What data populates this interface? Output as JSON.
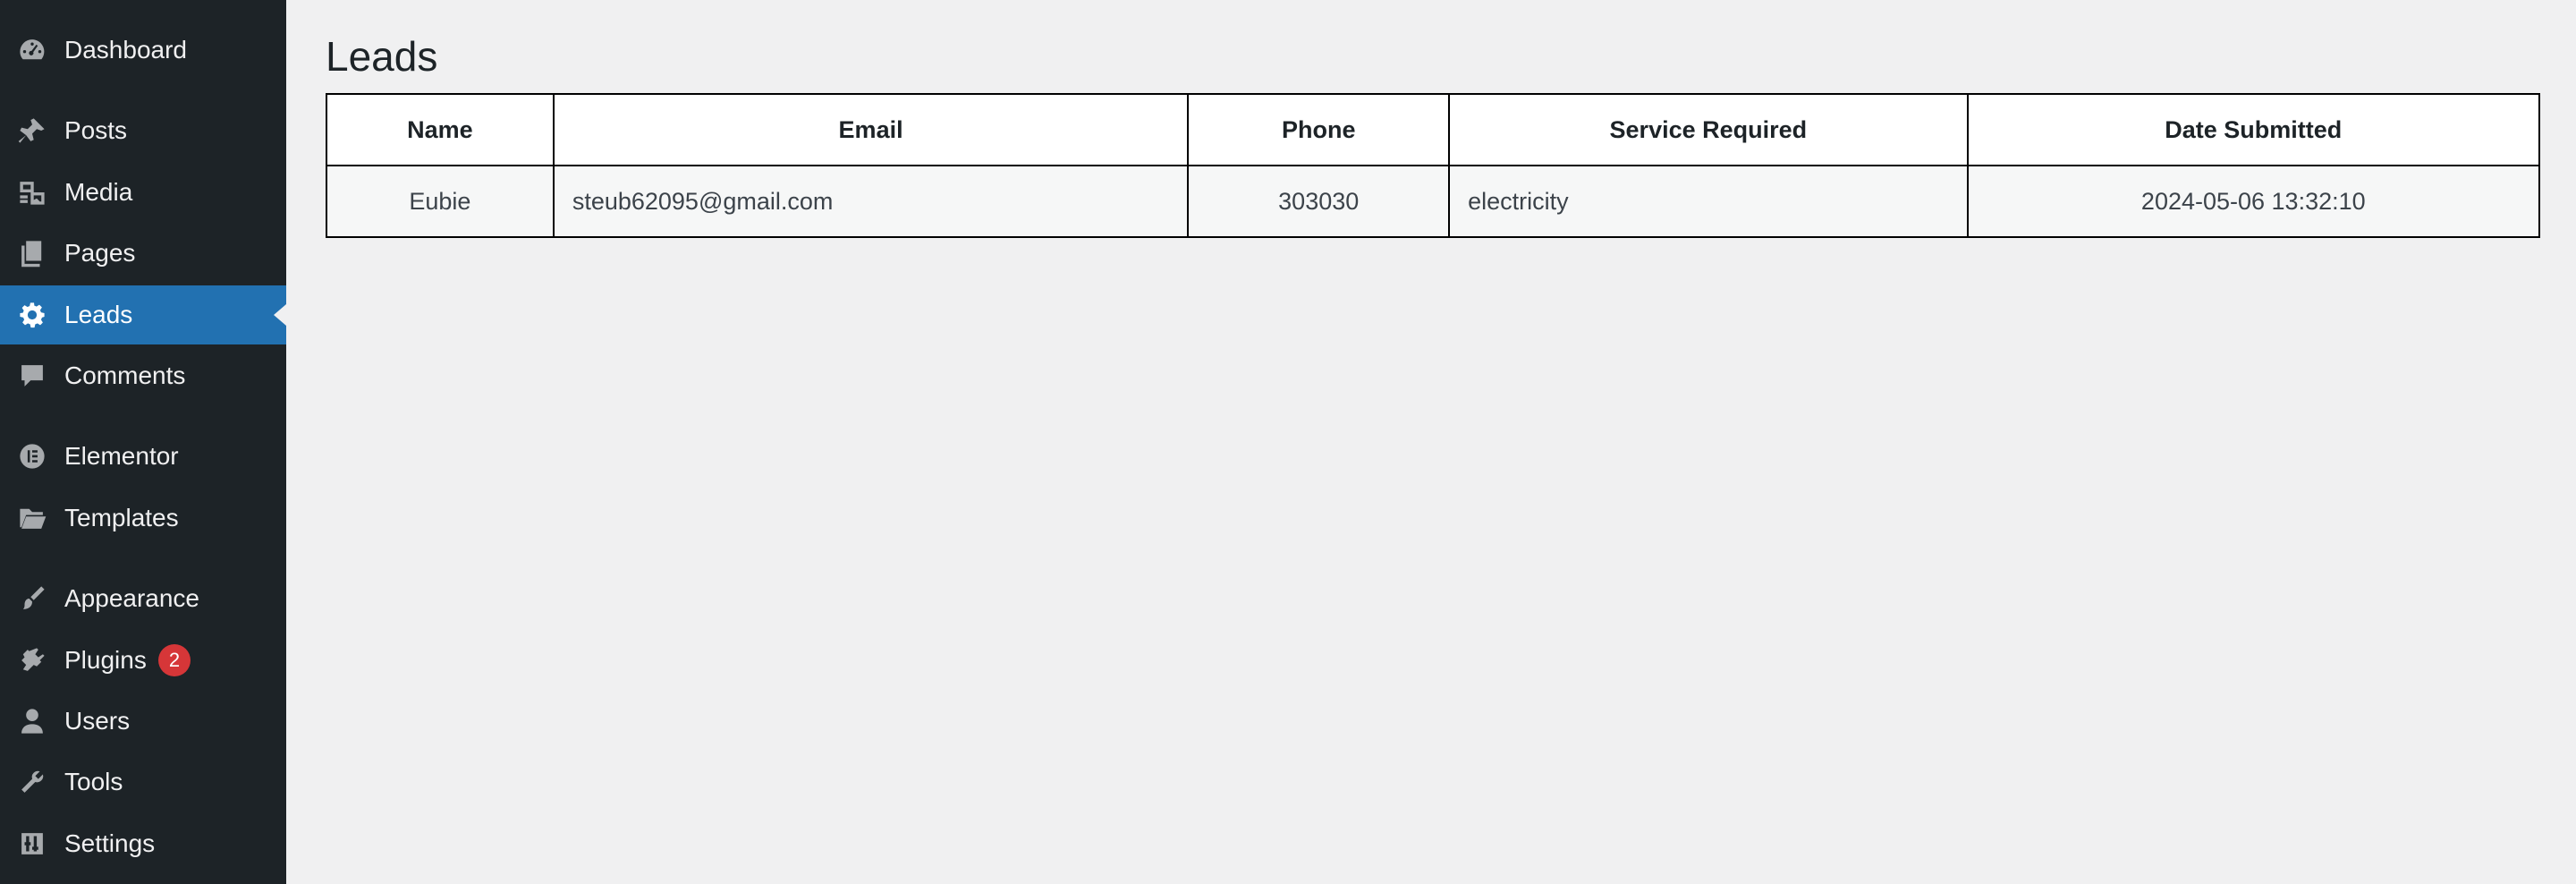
{
  "sidebar": {
    "items": [
      {
        "label": "Dashboard",
        "icon": "dashboard-icon"
      },
      {
        "label": "Posts",
        "icon": "pushpin-icon"
      },
      {
        "label": "Media",
        "icon": "media-icon"
      },
      {
        "label": "Pages",
        "icon": "pages-icon"
      },
      {
        "label": "Leads",
        "icon": "gear-icon",
        "active": true
      },
      {
        "label": "Comments",
        "icon": "comment-icon"
      },
      {
        "label": "Elementor",
        "icon": "elementor-icon"
      },
      {
        "label": "Templates",
        "icon": "folder-icon"
      },
      {
        "label": "Appearance",
        "icon": "paintbrush-icon"
      },
      {
        "label": "Plugins",
        "icon": "plug-icon",
        "badge": "2"
      },
      {
        "label": "Users",
        "icon": "user-icon"
      },
      {
        "label": "Tools",
        "icon": "wrench-icon"
      },
      {
        "label": "Settings",
        "icon": "settings-sliders-icon"
      }
    ]
  },
  "main": {
    "title": "Leads",
    "table": {
      "headers": [
        "Name",
        "Email",
        "Phone",
        "Service Required",
        "Date Submitted"
      ],
      "rows": [
        [
          "Eubie",
          "steub62095@gmail.com",
          "303030",
          "electricity",
          "2024-05-06 13:32:10"
        ]
      ]
    }
  },
  "colors": {
    "sidebar_bg": "#1d2327",
    "active_item": "#2271b1",
    "badge": "#d63638",
    "page_bg": "#f0f0f1"
  }
}
